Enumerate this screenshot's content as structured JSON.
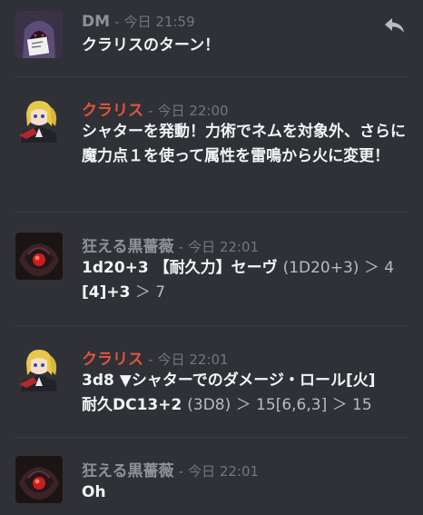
{
  "messages": [
    {
      "author": "DM",
      "author_color": "#8e9297",
      "avatar": "hooded-figure-avatar",
      "dash": "-",
      "time": "今日 21:59",
      "lines": [
        "クラリスのターン！"
      ]
    },
    {
      "author": "クラリス",
      "author_color": "#e0553c",
      "avatar": "blonde-girl-avatar",
      "dash": "-",
      "time": "今日 22:00",
      "lines": [
        "シャターを発動！力術でネムを対象外、さらに魔力点１を使って属性を雷鳴から火に変更！"
      ]
    },
    {
      "author": "狂える黒薔薇",
      "author_color": "#8e9297",
      "avatar": "black-rose-avatar",
      "dash": "-",
      "time": "今日 22:01",
      "roll": {
        "lead": "1d20+3 【耐久力】セーヴ ",
        "expr": "(1D20+3)",
        "gt1": " ＞ 4",
        "detail": "[4]+3",
        "gt2": " ＞ 7"
      }
    },
    {
      "author": "クラリス",
      "author_color": "#e0553c",
      "avatar": "blonde-girl-avatar",
      "dash": "-",
      "time": "今日 22:01",
      "roll": {
        "line1": "3d8 ▼シャターでのダメージ・ロール[火]",
        "lead": "耐久DC13+2 ",
        "expr": "(3D8)",
        "gt1": " ＞ 15[6,6,3] ＞ 15"
      }
    },
    {
      "author": "狂える黒薔薇",
      "author_color": "#8e9297",
      "avatar": "black-rose-avatar",
      "dash": "-",
      "time": "今日 22:01",
      "lines": [
        "Oh"
      ]
    }
  ],
  "reply_icon": "reply-arrow-icon"
}
